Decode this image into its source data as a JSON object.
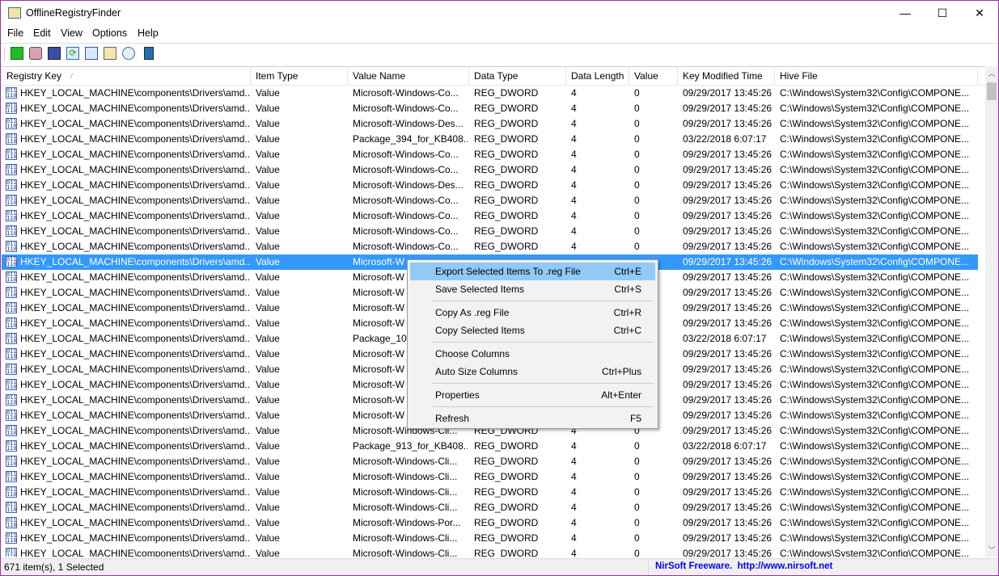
{
  "window": {
    "title": "OfflineRegistryFinder",
    "controls": [
      "—",
      "☐",
      "✕"
    ]
  },
  "menubar": [
    "File",
    "Edit",
    "View",
    "Options",
    "Help"
  ],
  "toolbar": [
    "new-search-icon",
    "snapshot-icon",
    "save-icon",
    "refresh-icon",
    "copy-icon",
    "properties-icon",
    "find-icon",
    "exit-icon"
  ],
  "columns": [
    "Registry Key",
    "Item Type",
    "Value Name",
    "Data Type",
    "Data Length",
    "Value",
    "Key Modified Time",
    "Hive File"
  ],
  "sort_indicator": "⁄",
  "rows": [
    [
      "HKEY_LOCAL_MACHINE\\components\\Drivers\\amd...",
      "Value",
      "Microsoft-Windows-Co...",
      "REG_DWORD",
      "4",
      "0",
      "09/29/2017 13:45:26",
      "C:\\Windows\\System32\\Config\\COMPONE..."
    ],
    [
      "HKEY_LOCAL_MACHINE\\components\\Drivers\\amd...",
      "Value",
      "Microsoft-Windows-Co...",
      "REG_DWORD",
      "4",
      "0",
      "09/29/2017 13:45:26",
      "C:\\Windows\\System32\\Config\\COMPONE..."
    ],
    [
      "HKEY_LOCAL_MACHINE\\components\\Drivers\\amd...",
      "Value",
      "Microsoft-Windows-Des...",
      "REG_DWORD",
      "4",
      "0",
      "09/29/2017 13:45:26",
      "C:\\Windows\\System32\\Config\\COMPONE..."
    ],
    [
      "HKEY_LOCAL_MACHINE\\components\\Drivers\\amd...",
      "Value",
      "Package_394_for_KB408...",
      "REG_DWORD",
      "4",
      "0",
      "03/22/2018 6:07:17",
      "C:\\Windows\\System32\\Config\\COMPONE..."
    ],
    [
      "HKEY_LOCAL_MACHINE\\components\\Drivers\\amd...",
      "Value",
      "Microsoft-Windows-Co...",
      "REG_DWORD",
      "4",
      "0",
      "09/29/2017 13:45:26",
      "C:\\Windows\\System32\\Config\\COMPONE..."
    ],
    [
      "HKEY_LOCAL_MACHINE\\components\\Drivers\\amd...",
      "Value",
      "Microsoft-Windows-Co...",
      "REG_DWORD",
      "4",
      "0",
      "09/29/2017 13:45:26",
      "C:\\Windows\\System32\\Config\\COMPONE..."
    ],
    [
      "HKEY_LOCAL_MACHINE\\components\\Drivers\\amd...",
      "Value",
      "Microsoft-Windows-Des...",
      "REG_DWORD",
      "4",
      "0",
      "09/29/2017 13:45:26",
      "C:\\Windows\\System32\\Config\\COMPONE..."
    ],
    [
      "HKEY_LOCAL_MACHINE\\components\\Drivers\\amd...",
      "Value",
      "Microsoft-Windows-Co...",
      "REG_DWORD",
      "4",
      "0",
      "09/29/2017 13:45:26",
      "C:\\Windows\\System32\\Config\\COMPONE..."
    ],
    [
      "HKEY_LOCAL_MACHINE\\components\\Drivers\\amd...",
      "Value",
      "Microsoft-Windows-Co...",
      "REG_DWORD",
      "4",
      "0",
      "09/29/2017 13:45:26",
      "C:\\Windows\\System32\\Config\\COMPONE..."
    ],
    [
      "HKEY_LOCAL_MACHINE\\components\\Drivers\\amd...",
      "Value",
      "Microsoft-Windows-Co...",
      "REG_DWORD",
      "4",
      "0",
      "09/29/2017 13:45:26",
      "C:\\Windows\\System32\\Config\\COMPONE..."
    ],
    [
      "HKEY_LOCAL_MACHINE\\components\\Drivers\\amd...",
      "Value",
      "Microsoft-Windows-Co...",
      "REG_DWORD",
      "4",
      "0",
      "09/29/2017 13:45:26",
      "C:\\Windows\\System32\\Config\\COMPONE..."
    ],
    [
      "HKEY_LOCAL_MACHINE\\components\\Drivers\\amd...",
      "Value",
      "Microsoft-W",
      "",
      "",
      "",
      "09/29/2017 13:45:26",
      "C:\\Windows\\System32\\Config\\COMPONE..."
    ],
    [
      "HKEY_LOCAL_MACHINE\\components\\Drivers\\amd...",
      "Value",
      "Microsoft-W",
      "",
      "",
      "",
      "09/29/2017 13:45:26",
      "C:\\Windows\\System32\\Config\\COMPONE..."
    ],
    [
      "HKEY_LOCAL_MACHINE\\components\\Drivers\\amd...",
      "Value",
      "Microsoft-W",
      "",
      "",
      "",
      "09/29/2017 13:45:26",
      "C:\\Windows\\System32\\Config\\COMPONE..."
    ],
    [
      "HKEY_LOCAL_MACHINE\\components\\Drivers\\amd...",
      "Value",
      "Microsoft-W",
      "",
      "",
      "",
      "09/29/2017 13:45:26",
      "C:\\Windows\\System32\\Config\\COMPONE..."
    ],
    [
      "HKEY_LOCAL_MACHINE\\components\\Drivers\\amd...",
      "Value",
      "Microsoft-W",
      "",
      "",
      "",
      "09/29/2017 13:45:26",
      "C:\\Windows\\System32\\Config\\COMPONE..."
    ],
    [
      "HKEY_LOCAL_MACHINE\\components\\Drivers\\amd...",
      "Value",
      "Package_108",
      "",
      "",
      "",
      "03/22/2018 6:07:17",
      "C:\\Windows\\System32\\Config\\COMPONE..."
    ],
    [
      "HKEY_LOCAL_MACHINE\\components\\Drivers\\amd...",
      "Value",
      "Microsoft-W",
      "",
      "",
      "",
      "09/29/2017 13:45:26",
      "C:\\Windows\\System32\\Config\\COMPONE..."
    ],
    [
      "HKEY_LOCAL_MACHINE\\components\\Drivers\\amd...",
      "Value",
      "Microsoft-W",
      "",
      "",
      "",
      "09/29/2017 13:45:26",
      "C:\\Windows\\System32\\Config\\COMPONE..."
    ],
    [
      "HKEY_LOCAL_MACHINE\\components\\Drivers\\amd...",
      "Value",
      "Microsoft-W",
      "",
      "",
      "",
      "09/29/2017 13:45:26",
      "C:\\Windows\\System32\\Config\\COMPONE..."
    ],
    [
      "HKEY_LOCAL_MACHINE\\components\\Drivers\\amd...",
      "Value",
      "Microsoft-W",
      "",
      "",
      "",
      "09/29/2017 13:45:26",
      "C:\\Windows\\System32\\Config\\COMPONE..."
    ],
    [
      "HKEY_LOCAL_MACHINE\\components\\Drivers\\amd...",
      "Value",
      "Microsoft-W",
      "",
      "",
      "",
      "09/29/2017 13:45:26",
      "C:\\Windows\\System32\\Config\\COMPONE..."
    ],
    [
      "HKEY_LOCAL_MACHINE\\components\\Drivers\\amd...",
      "Value",
      "Microsoft-Windows-Cli...",
      "REG_DWORD",
      "4",
      "0",
      "09/29/2017 13:45:26",
      "C:\\Windows\\System32\\Config\\COMPONE..."
    ],
    [
      "HKEY_LOCAL_MACHINE\\components\\Drivers\\amd...",
      "Value",
      "Package_913_for_KB408...",
      "REG_DWORD",
      "4",
      "0",
      "03/22/2018 6:07:17",
      "C:\\Windows\\System32\\Config\\COMPONE..."
    ],
    [
      "HKEY_LOCAL_MACHINE\\components\\Drivers\\amd...",
      "Value",
      "Microsoft-Windows-Cli...",
      "REG_DWORD",
      "4",
      "0",
      "09/29/2017 13:45:26",
      "C:\\Windows\\System32\\Config\\COMPONE..."
    ],
    [
      "HKEY_LOCAL_MACHINE\\components\\Drivers\\amd...",
      "Value",
      "Microsoft-Windows-Cli...",
      "REG_DWORD",
      "4",
      "0",
      "09/29/2017 13:45:26",
      "C:\\Windows\\System32\\Config\\COMPONE..."
    ],
    [
      "HKEY_LOCAL_MACHINE\\components\\Drivers\\amd...",
      "Value",
      "Microsoft-Windows-Cli...",
      "REG_DWORD",
      "4",
      "0",
      "09/29/2017 13:45:26",
      "C:\\Windows\\System32\\Config\\COMPONE..."
    ],
    [
      "HKEY_LOCAL_MACHINE\\components\\Drivers\\amd...",
      "Value",
      "Microsoft-Windows-Cli...",
      "REG_DWORD",
      "4",
      "0",
      "09/29/2017 13:45:26",
      "C:\\Windows\\System32\\Config\\COMPONE..."
    ],
    [
      "HKEY_LOCAL_MACHINE\\components\\Drivers\\amd...",
      "Value",
      "Microsoft-Windows-Por...",
      "REG_DWORD",
      "4",
      "0",
      "09/29/2017 13:45:26",
      "C:\\Windows\\System32\\Config\\COMPONE..."
    ],
    [
      "HKEY_LOCAL_MACHINE\\components\\Drivers\\amd...",
      "Value",
      "Microsoft-Windows-Cli...",
      "REG_DWORD",
      "4",
      "0",
      "09/29/2017 13:45:26",
      "C:\\Windows\\System32\\Config\\COMPONE..."
    ],
    [
      "HKEY_LOCAL_MACHINE\\components\\Drivers\\amd...",
      "Value",
      "Microsoft-Windows-Cli...",
      "REG_DWORD",
      "4",
      "0",
      "09/29/2017 13:45:26",
      "C:\\Windows\\System32\\Config\\COMPONE..."
    ]
  ],
  "selected_row": 11,
  "context_menu": [
    {
      "label": "Export Selected Items To .reg File",
      "shortcut": "Ctrl+E",
      "highlighted": true
    },
    {
      "label": "Save Selected Items",
      "shortcut": "Ctrl+S"
    },
    {
      "separator": true
    },
    {
      "label": "Copy As .reg File",
      "shortcut": "Ctrl+R"
    },
    {
      "label": "Copy Selected Items",
      "shortcut": "Ctrl+C"
    },
    {
      "separator": true
    },
    {
      "label": "Choose Columns",
      "shortcut": ""
    },
    {
      "label": "Auto Size Columns",
      "shortcut": "Ctrl+Plus"
    },
    {
      "separator": true
    },
    {
      "label": "Properties",
      "shortcut": "Alt+Enter"
    },
    {
      "separator": true
    },
    {
      "label": "Refresh",
      "shortcut": "F5"
    }
  ],
  "status": {
    "count": "671 item(s), 1 Selected",
    "credit": "NirSoft Freeware.  http://www.nirsoft.net"
  },
  "colors": {
    "selection": "#3399ff",
    "menu_highlight": "#91c9f7",
    "credit": "#0000ff",
    "window_border": "#9b2fae"
  }
}
